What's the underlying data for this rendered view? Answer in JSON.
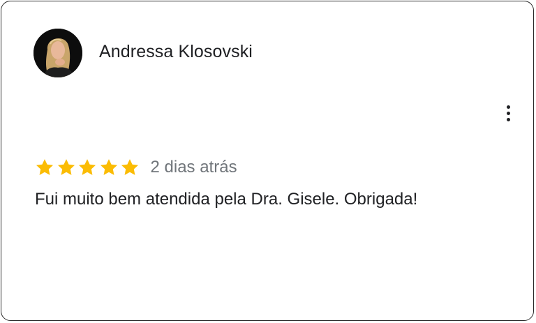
{
  "review": {
    "author": "Andressa Klosovski",
    "rating": 5,
    "rating_max": 5,
    "date": "2 dias atrás",
    "text": "Fui muito bem atendida pela Dra. Gisele. Obrigada!",
    "star_color": "#FBBC04"
  },
  "icons": {
    "more": "more-vert-icon",
    "star": "star-icon"
  }
}
